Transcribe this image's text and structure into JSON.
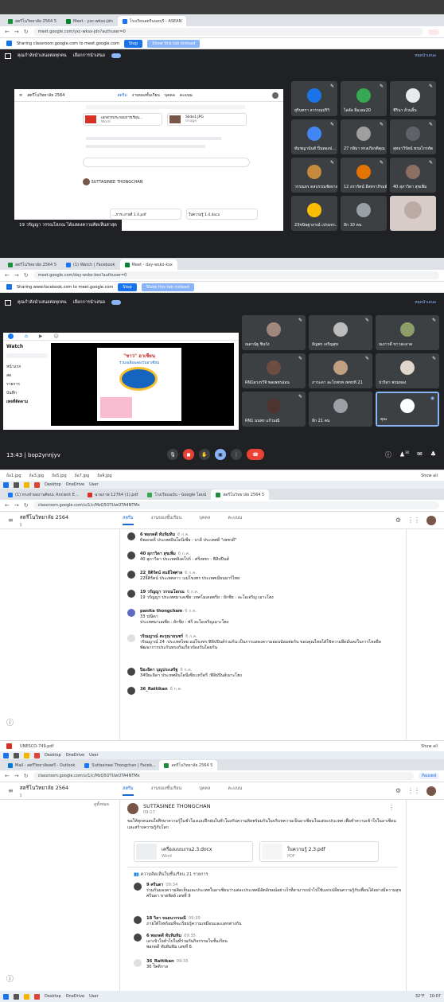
{
  "s1": {
    "tabs": [
      "สตรีโนวิทยาลัย 2564 5",
      "Meet - yxc-wksx-jdn",
      "โรงเรียนสตรีนนทบุรี - ASEAN"
    ],
    "url": "meet.google.com/yxc-wksx-jdn?authuser=0",
    "share_text": "Sharing classroom.google.com to meet.google.com",
    "stop": "Stop",
    "show_this_tab": "Show this tab instead",
    "presenting": "คุณกำลังนำเสนอต่อทุกคน",
    "layout_label": "เลือกการนำเสนอ",
    "present_link": "หยุดนำเสนอ",
    "doc_header": "สตรีโนวิทยาลัย 2564",
    "doc_tabs": [
      "สตรีม",
      "งานของชั้นเรียน",
      "บุคคล",
      "คะแนน"
    ],
    "doc_file1": "เอกสารประกอบการเรียน...",
    "doc_file2": "Word",
    "doc_file3": "Slide1.JPG",
    "doc_file4": "Image",
    "doc_poster": "SUTTASINEE THONGCHAN",
    "doc_file5": "...ภาระงานที่ 1.4.pdf",
    "doc_file6": "ใบความรู้ 1.4.docx",
    "caption": "19 วรัญญา วรรณโสภณ ได้แสดงความคิดเห็นล่าสุด",
    "tiles": [
      "สุรินทรา ลวรรณปริวิ",
      "ไลลัล อิ่มเอม20",
      "ชีรินา ล้วนลิ้น",
      "ทัมชญานันท์ ปิ่นทองป...",
      "27 กสิมา ทรงเกียรติคุณ",
      "สุทธาวีรัตน์ พรมไกรทัต",
      "วรรณธร ดลบรรณชัยยาง",
      "12 อรวรัตน์ ลีลทราภิรมย์",
      "40 สุภาวิดา สุขเพิ่ม",
      "23ขนิษฐาภรณ์ เปรมจร...",
      "อีก 10 คน",
      ""
    ]
  },
  "s2": {
    "tabs": [
      "สตรีโนวิทยาลัย 2564 5",
      "(1) Watch | Facebook",
      "Meet - day-wsko-ksx"
    ],
    "url": "meet.google.com/day-wsko-kex?authuser=0",
    "share_text": "Sharing www.facebook.com to meet.google.com",
    "stop": "Stop",
    "show_this_tab": "Show this tab instead",
    "presenting": "คุณกำลังนำเสนอต่อทุกคน",
    "layout_label": "เลือกการนำเสนอ",
    "present_link": "หยุดนำเสนอ",
    "fb_watch": "Watch",
    "fb_items": [
      "หน้าแรก",
      "สด",
      "รายการ",
      "บันทึก"
    ],
    "fb_section": "เพจที่ติดตาม",
    "video_title": "\"ชาว\" อาเซียน",
    "video_sub": "ร่วมเฉลิมฉลองวันอาเซียน",
    "tiles": [
      "ณดานัฐ ชินวัง",
      "ธัญพร เจริญสุข",
      "ณภาวดี ขาวสะอาด",
      "RN1ดวงรวิจิ พลเพชรอ่อน",
      "ภาระดา ละโกพรพ เพชรทิ 21",
      "ปวริดา พรมทอง",
      "RN1 มนพร แก้วมณี",
      "อีก 21 คน",
      "คุณ"
    ],
    "clock": "13:43",
    "code": "bop2ynnjyv",
    "people_badge": "30",
    "downloads": [
      "ถ้อ1.jpg",
      "ถ้อ3.jpg",
      "ถ้อ5.jpg",
      "ถ้อ7.jpg",
      "ถ้อ9.jpg"
    ],
    "show_all": "Show all"
  },
  "s3": {
    "tabs": [
      "(1) ทรงจำผลงานศิลปะ Ancient E...",
      "ฉายภาพ 12764 (1).pdf",
      "โรงเรียนฉบับ - Google โดยน์",
      "สตรีโนวิทยาลัย 2564 5"
    ],
    "url": "classroom.google.com/u/1/c/MzQ5OTUwOTA4NTMx",
    "class_name": "สตรีโนวิทยาลัย 2564",
    "class_sub": "5",
    "class_tabs": [
      "สตรีม",
      "งานของชั้นเรียน",
      "บุคคล",
      "คะแนน"
    ],
    "comments": [
      {
        "who": "6 พอกดดี ทับทิมทิม",
        "time": "6 ก.ค.",
        "text": "6พอกดดี ประเทศอินโดนีเซีย : บาลี ประเทศดี \"เพชรดี\""
      },
      {
        "who": "40 สุภาวิดา สุขเพิ่ม",
        "time": "6 ก.ค.",
        "text": "40 สุภาวิดา ประเทศสิงคโปร์ : ศรีเพชร : ฟิลิปปินส์"
      },
      {
        "who": "22_ธิติรัตน์ สนธิไพศาล",
        "time": "6 ก.ค.",
        "text": "22ธิติรัตน์ ประเทศลาว :แม่โขงทร ประเทศเมียนมาร์ไทย"
      },
      {
        "who": "19 วรัญญา วรรณโสภณ",
        "time": "6 ก.ค.",
        "text": "19 วรัญญา ประเทศมาเลเซีย :เทศโมเดลตรีย : ผักชีย : ละโอเจริญ เมาะโฮง"
      },
      {
        "who": "panita thongcham",
        "time": "6 ก.ค.",
        "text": "33 ปณิดา"
      },
      {
        "who": "",
        "time": "",
        "text": "ประเทศมาเลเซีย : ผักชีย : ฟรี ละโอเจริญเมาะโฮง"
      },
      {
        "who": "วริณญาณ์ ตะรุณาธนชร์",
        "time": "6 ก.ค.",
        "text": "วริณญาณ์ 24 :ประเทศไทย:แม่โขงทร:ฟิลิปปินส์ร่วมกัน:เป็นการแสดงความอ่อนน้อมต่อกัน ขอบคุณไทยได้ใช้ความยึดมั่นคงในการไหลยืดพัฒนาการประกันทรงกันเกี่ยวข้องกันโดยกัน"
      },
      {
        "who": "ปิยะธิดา บุญประเสริฐ",
        "time": "6 ก.ค.",
        "text": "34ปิยะธิดา ประเทศอินโดนีเซีย:เหวีดรี :ฟิลิปปินส์เมาะโฮง"
      },
      {
        "who": "36_Rattikan",
        "time": "6 ก.ค.",
        "text": ""
      }
    ],
    "download": "UNESCO-749.pdf",
    "show_all": "Show all"
  },
  "s4": {
    "tabs": [
      "Mail - สตรีวิทยาลัยสตรี - Outlook",
      "Suttasinee Thongchan | Faceb...",
      "สตรีโนวิทยาลัย 2564 5"
    ],
    "url": "classroom.google.com/u/1/c/MzQ5OTUwOTA4NTMx",
    "paused": "Paused",
    "class_name": "สตรีโนวิทยาลัย 2564",
    "class_sub": "5",
    "class_tabs": [
      "สตรีม",
      "งานของชั้นเรียน",
      "บุคคล",
      "คะแนน"
    ],
    "side_text": "ดูทั้งหมด",
    "poster": "SUTTASINEE THONGCHAN",
    "post_time": "09:17",
    "post_text": "ขอให้ทุกคนสนใจศึกษาความรู้ในชั่วโมงและฝึกฝนในชั่วโมงกับความคิดพร้อมกันในบริบทความเป็นอาเซียนในแต่ละประเทศ เพื่อทำความเข้าใจในอาเซียนและสร้างความรู้กับโลก",
    "attach1_name": "เครื่องแบบงาน2.3.docx",
    "attach1_type": "Word",
    "attach2_name": "ใบความรู้ 2.3.pdf",
    "attach2_type": "PDF",
    "comments_count": "ความคิดเห็นในชั้นเรียน 21 รายการ",
    "comments": [
      {
        "who": "9 ศรีนดา",
        "time": "09:34",
        "text": "ร่วมกันมองความคิดเห็นและประเทศในอาเซียนว่าแต่ละประเทศมีอัตลักษณ์อย่างไรที่สามารถนำไปใช้แลกเปลี่ยนความรู้กับเพื่อนได้อย่างมีความสุข",
        "extra": "ศรีนดา ขาดพิลย์ เลขที่ 9"
      },
      {
        "who": "18 วิลา จนอนวรรมณี",
        "time": "09:35",
        "text": "ภายใต้ใจพร้อมที่จะเรียนรู้ความเหมือนและแตกต่างกัน",
        "extra": ""
      },
      {
        "who": "6 พอกดดี ทับทิมทิม",
        "time": "09:35",
        "text": "เอาเข้าใจทำไปในที่ร่วมกันกิจกรรมในชั้นเรียน",
        "extra": "พอกดดี ทับทิมทิม เลขที่ 6"
      },
      {
        "who": "36_Rattikan",
        "time": "09:35",
        "text": "36 รัตติกาล",
        "extra": ""
      }
    ],
    "clock": "10:07",
    "temp": "32°F"
  },
  "taskbar_items": [
    "Desktop",
    "OneDrive",
    "User"
  ],
  "colors": {
    "meet_bg": "#202124",
    "blue": "#1a73e8",
    "classroom_blue": "#1967d2",
    "end_call": "#ea4335"
  }
}
